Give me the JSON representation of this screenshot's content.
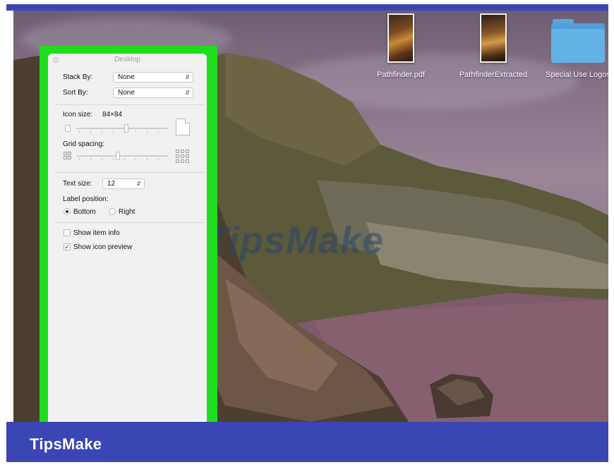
{
  "brand": {
    "name": "TipsMake",
    "watermark": "TipsMake"
  },
  "colors": {
    "band": "#3a46b4",
    "highlight_border": "#1fdc1f",
    "panel_bg": "#f1f1f1",
    "folder": "#4e9fd8"
  },
  "desktop_icons": [
    {
      "label": "Pathfinder.pdf",
      "icon": "pdf-document-icon"
    },
    {
      "label": "PathfinderExtracted",
      "icon": "pdf-document-icon"
    },
    {
      "label": "Special Use Logos",
      "icon": "folder-icon"
    }
  ],
  "view_options": {
    "title": "Desktop",
    "stack_by": {
      "label": "Stack By:",
      "value": "None"
    },
    "sort_by": {
      "label": "Sort By:",
      "value": "None"
    },
    "icon_size": {
      "label": "Icon size:",
      "value": "84×84",
      "level": 0.55
    },
    "grid_spacing": {
      "label": "Grid spacing:",
      "level": 0.45
    },
    "text_size": {
      "label": "Text size:",
      "value": "12"
    },
    "label_position": {
      "label": "Label position:",
      "options": [
        {
          "label": "Bottom",
          "selected": true
        },
        {
          "label": "Right",
          "selected": false
        }
      ]
    },
    "show_item_info": {
      "label": "Show item info",
      "checked": false
    },
    "show_icon_preview": {
      "label": "Show icon preview",
      "checked": true
    }
  }
}
